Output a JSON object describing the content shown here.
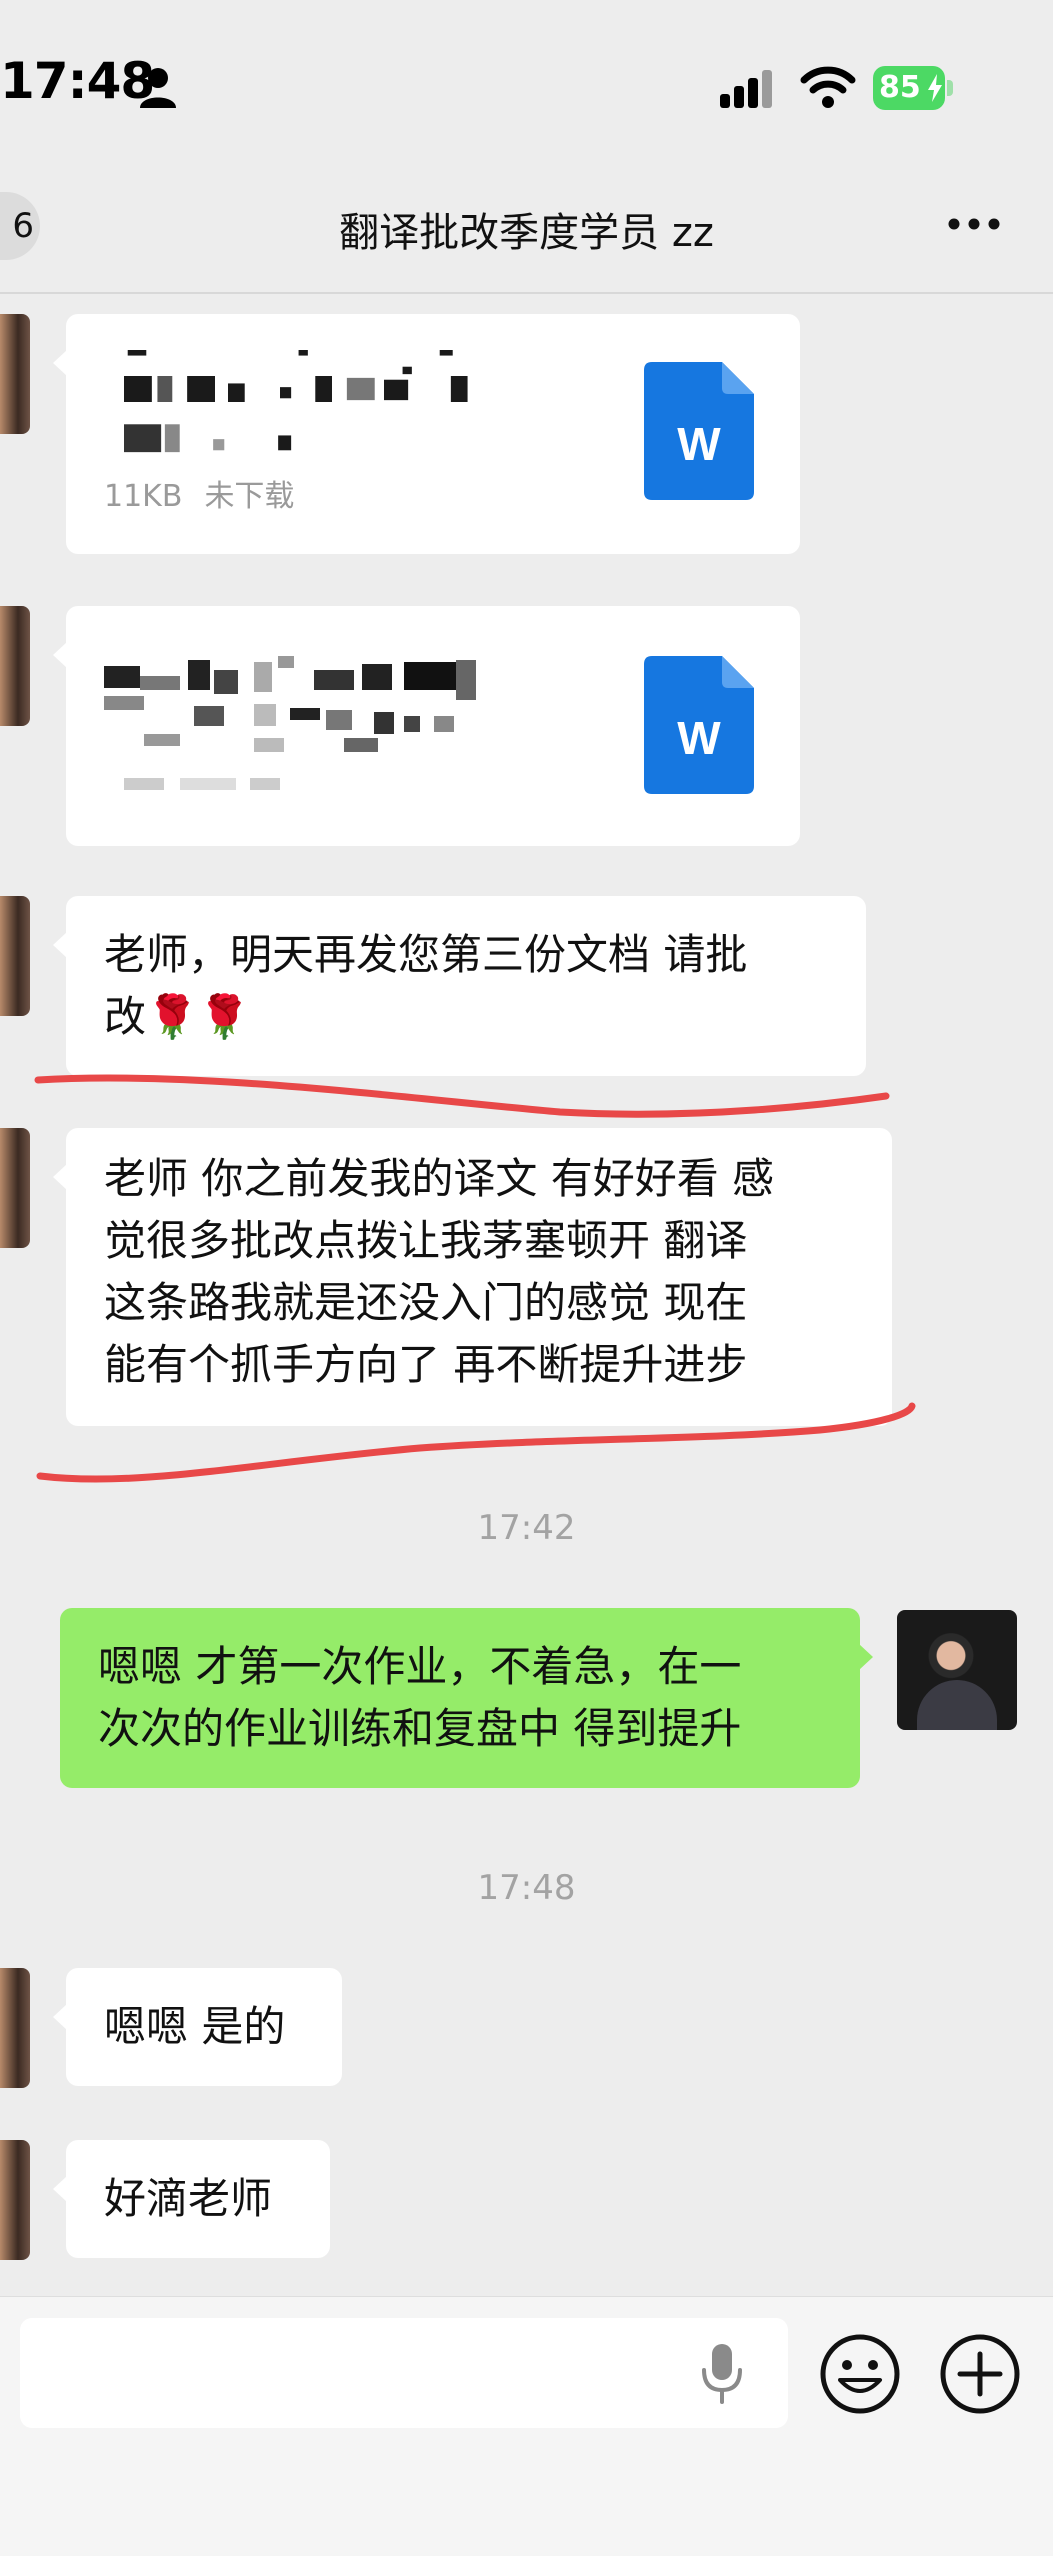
{
  "status_bar": {
    "time": "17:48",
    "battery": "85"
  },
  "nav": {
    "back_badge": "6",
    "title": "翻译批改季度学员 zz"
  },
  "messages": [
    {
      "type": "file",
      "side": "left",
      "size": "11KB",
      "status": "未下载",
      "file_icon_letter": "W"
    },
    {
      "type": "file",
      "side": "left",
      "file_icon_letter": "W"
    },
    {
      "type": "text",
      "side": "left",
      "text": "老师，明天再发您第三份文档 请批\n改🌹🌹"
    },
    {
      "type": "text",
      "side": "left",
      "text": "老师 你之前发我的译文 有好好看 感\n觉很多批改点拨让我茅塞顿开 翻译\n这条路我就是还没入门的感觉 现在\n能有个抓手方向了 再不断提升进步"
    },
    {
      "type": "time",
      "text": "17:42"
    },
    {
      "type": "text",
      "side": "right",
      "text": "嗯嗯 才第一次作业，不着急，在一\n次次的作业训练和复盘中 得到提升"
    },
    {
      "type": "time",
      "text": "17:48"
    },
    {
      "type": "text",
      "side": "left",
      "text": "嗯嗯 是的"
    },
    {
      "type": "text",
      "side": "left",
      "text": "好滴老师"
    }
  ],
  "colors": {
    "background": "#ededed",
    "incoming_bubble": "#ffffff",
    "outgoing_bubble": "#95ec69",
    "word_icon": "#1677e0",
    "annotation_stroke": "#e84848",
    "battery": "#4cd964"
  }
}
